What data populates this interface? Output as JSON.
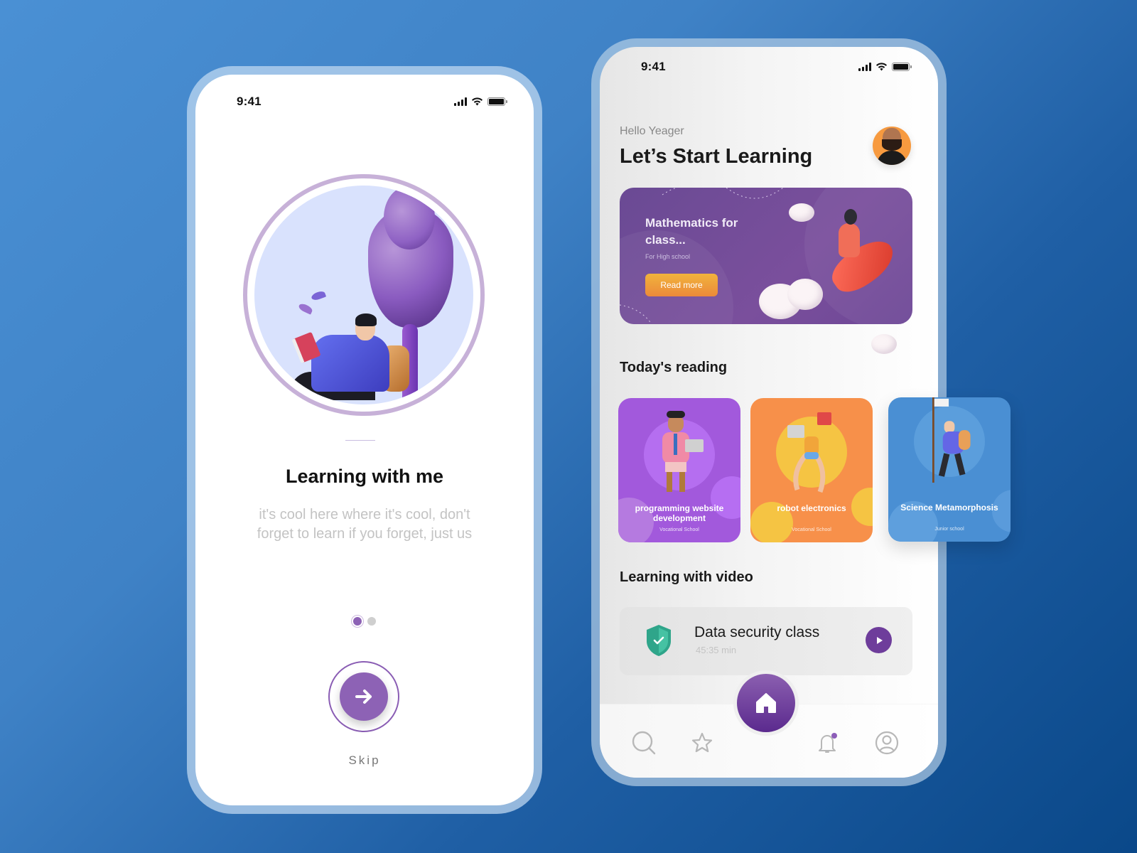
{
  "left_phone": {
    "status_bar": {
      "time": "9:41",
      "icons": [
        "signal-icon",
        "wifi-icon",
        "battery-icon"
      ]
    },
    "illustration": "person-reading-under-tree",
    "title": "Learning with me",
    "description": "it's cool here where it's cool, don't forget to learn if you forget, just us",
    "pagination": {
      "total": 2,
      "active_index": 0
    },
    "next_button_icon": "arrow-right-icon",
    "skip_label": "Skip"
  },
  "right_phone": {
    "status_bar": {
      "time": "9:41",
      "icons": [
        "signal-icon",
        "wifi-icon",
        "battery-icon"
      ]
    },
    "greeting": "Hello Yeager",
    "headline": "Let’s Start Learning",
    "avatar": "user-avatar",
    "banner": {
      "title": "Mathematics for class...",
      "subtitle": "For High school",
      "button_label": "Read more"
    },
    "todays_reading": {
      "title": "Today's reading",
      "cards": [
        {
          "title": "programming website development",
          "subtitle": "Vocational School",
          "color": "#a259dc"
        },
        {
          "title": "robot electronics",
          "subtitle": "Vocational School",
          "color": "#f7904a"
        },
        {
          "title": "Science Metamorphosis",
          "subtitle": "Junior school",
          "color": "#4a8fd3"
        }
      ]
    },
    "learning_video": {
      "title": "Learning with video",
      "items": [
        {
          "title": "Data security class",
          "duration": "45:35 min",
          "icon": "shield-check-icon"
        }
      ]
    },
    "tab_bar": {
      "items": [
        "search",
        "favorites",
        "home",
        "notifications",
        "profile"
      ],
      "active": "home",
      "notification_badge": true
    }
  },
  "colors": {
    "accent_purple": "#8d62b5",
    "deep_purple": "#6e3d9b",
    "banner_purple": "#6d4796",
    "orange_button": "#ec8a3a",
    "teal_shield": "#2fa58a",
    "background_blue": "#3f82c6"
  }
}
